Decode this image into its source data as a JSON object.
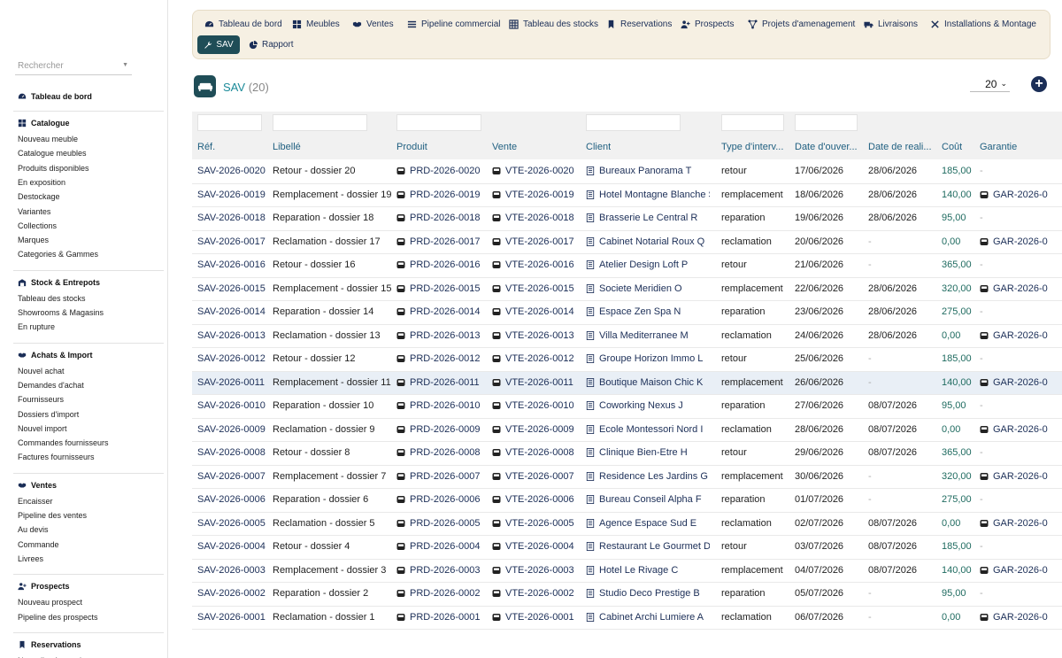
{
  "sidebar": {
    "search_placeholder": "Rechercher",
    "dashboard": "Tableau de bord",
    "sections": [
      {
        "title": "Catalogue",
        "icon": "grid-icon",
        "items": [
          "Nouveau meuble",
          "Catalogue meubles",
          "Produits disponibles",
          "En exposition",
          "Destockage",
          "Variantes",
          "Collections",
          "Marques",
          "Categories & Gammes"
        ]
      },
      {
        "title": "Stock & Entrepots",
        "icon": "warehouse-icon",
        "items": [
          "Tableau des stocks",
          "Showrooms & Magasins",
          "En rupture"
        ]
      },
      {
        "title": "Achats & Import",
        "icon": "handshake-icon",
        "items": [
          "Nouvel achat",
          "Demandes d'achat",
          "Fournisseurs",
          "Dossiers d'import",
          "Nouvel import",
          "Commandes fournisseurs",
          "Factures fournisseurs"
        ]
      },
      {
        "title": "Ventes",
        "icon": "handshake-icon",
        "items": [
          "Encaisser",
          "Pipeline des ventes",
          "Au devis",
          "Commande",
          "Livrees"
        ]
      },
      {
        "title": "Prospects",
        "icon": "user-plus-icon",
        "items": [
          "Nouveau prospect",
          "Pipeline des prospects"
        ]
      },
      {
        "title": "Reservations",
        "icon": "bookmark-icon",
        "items": [
          "Nouvelle réservation"
        ]
      }
    ]
  },
  "topnav": {
    "items": [
      {
        "label": "Tableau de bord",
        "icon": "dashboard-icon"
      },
      {
        "label": "Meubles",
        "icon": "grid-icon"
      },
      {
        "label": "Ventes",
        "icon": "handshake-icon"
      },
      {
        "label": "Pipeline commercial",
        "icon": "list-icon"
      },
      {
        "label": "Tableau des stocks",
        "icon": "table-icon"
      },
      {
        "label": "Reservations",
        "icon": "bookmark-icon"
      },
      {
        "label": "Prospects",
        "icon": "user-plus-icon"
      },
      {
        "label": "Projets d'amenagement",
        "icon": "project-icon"
      },
      {
        "label": "Livraisons",
        "icon": "truck-icon"
      },
      {
        "label": "Installations & Montage",
        "icon": "tools-icon"
      }
    ],
    "active": {
      "label": "SAV",
      "icon": "wrench-icon"
    },
    "report": {
      "label": "Rapport",
      "icon": "pie-icon"
    }
  },
  "page": {
    "title": "SAV",
    "count": "(20)",
    "per_page": "20",
    "colors": {
      "accent": "#1b8a99",
      "primary": "#1b2e57",
      "active_bg": "#1f4d57",
      "money": "#1f6b60"
    }
  },
  "table": {
    "columns": [
      "Réf.",
      "Libellé",
      "Produit",
      "Vente",
      "Client",
      "Type d'interv...",
      "Date d'ouver...",
      "Date de reali...",
      "Coût",
      "Garantie"
    ],
    "rows": [
      {
        "ref": "SAV-2026-0020",
        "libelle": "Retour - dossier 20",
        "produit": "PRD-2026-0020",
        "vente": "VTE-2026-0020",
        "client": "Bureaux Panorama T",
        "type": "retour",
        "ouverture": "17/06/2026",
        "realisation": "28/06/2026",
        "cout": "185,00",
        "garantie": "-"
      },
      {
        "ref": "SAV-2026-0019",
        "libelle": "Remplacement - dossier 19",
        "produit": "PRD-2026-0019",
        "vente": "VTE-2026-0019",
        "client": "Hotel Montagne Blanche S",
        "type": "remplacement",
        "ouverture": "18/06/2026",
        "realisation": "28/06/2026",
        "cout": "140,00",
        "garantie": "GAR-2026-0"
      },
      {
        "ref": "SAV-2026-0018",
        "libelle": "Reparation - dossier 18",
        "produit": "PRD-2026-0018",
        "vente": "VTE-2026-0018",
        "client": "Brasserie Le Central R",
        "type": "reparation",
        "ouverture": "19/06/2026",
        "realisation": "28/06/2026",
        "cout": "95,00",
        "garantie": "-"
      },
      {
        "ref": "SAV-2026-0017",
        "libelle": "Reclamation - dossier 17",
        "produit": "PRD-2026-0017",
        "vente": "VTE-2026-0017",
        "client": "Cabinet Notarial Roux Q",
        "type": "reclamation",
        "ouverture": "20/06/2026",
        "realisation": "-",
        "cout": "0,00",
        "garantie": "GAR-2026-0"
      },
      {
        "ref": "SAV-2026-0016",
        "libelle": "Retour - dossier 16",
        "produit": "PRD-2026-0016",
        "vente": "VTE-2026-0016",
        "client": "Atelier Design Loft P",
        "type": "retour",
        "ouverture": "21/06/2026",
        "realisation": "-",
        "cout": "365,00",
        "garantie": "-"
      },
      {
        "ref": "SAV-2026-0015",
        "libelle": "Remplacement - dossier 15",
        "produit": "PRD-2026-0015",
        "vente": "VTE-2026-0015",
        "client": "Societe Meridien O",
        "type": "remplacement",
        "ouverture": "22/06/2026",
        "realisation": "28/06/2026",
        "cout": "320,00",
        "garantie": "GAR-2026-0"
      },
      {
        "ref": "SAV-2026-0014",
        "libelle": "Reparation - dossier 14",
        "produit": "PRD-2026-0014",
        "vente": "VTE-2026-0014",
        "client": "Espace Zen Spa N",
        "type": "reparation",
        "ouverture": "23/06/2026",
        "realisation": "28/06/2026",
        "cout": "275,00",
        "garantie": "-"
      },
      {
        "ref": "SAV-2026-0013",
        "libelle": "Reclamation - dossier 13",
        "produit": "PRD-2026-0013",
        "vente": "VTE-2026-0013",
        "client": "Villa Mediterranee M",
        "type": "reclamation",
        "ouverture": "24/06/2026",
        "realisation": "28/06/2026",
        "cout": "0,00",
        "garantie": "GAR-2026-0"
      },
      {
        "ref": "SAV-2026-0012",
        "libelle": "Retour - dossier 12",
        "produit": "PRD-2026-0012",
        "vente": "VTE-2026-0012",
        "client": "Groupe Horizon Immo L",
        "type": "retour",
        "ouverture": "25/06/2026",
        "realisation": "-",
        "cout": "185,00",
        "garantie": "-"
      },
      {
        "ref": "SAV-2026-0011",
        "libelle": "Remplacement - dossier 11",
        "produit": "PRD-2026-0011",
        "vente": "VTE-2026-0011",
        "client": "Boutique Maison Chic K",
        "type": "remplacement",
        "ouverture": "26/06/2026",
        "realisation": "-",
        "cout": "140,00",
        "garantie": "GAR-2026-0"
      },
      {
        "ref": "SAV-2026-0010",
        "libelle": "Reparation - dossier 10",
        "produit": "PRD-2026-0010",
        "vente": "VTE-2026-0010",
        "client": "Coworking Nexus J",
        "type": "reparation",
        "ouverture": "27/06/2026",
        "realisation": "08/07/2026",
        "cout": "95,00",
        "garantie": "-"
      },
      {
        "ref": "SAV-2026-0009",
        "libelle": "Reclamation - dossier 9",
        "produit": "PRD-2026-0009",
        "vente": "VTE-2026-0009",
        "client": "Ecole Montessori Nord I",
        "type": "reclamation",
        "ouverture": "28/06/2026",
        "realisation": "08/07/2026",
        "cout": "0,00",
        "garantie": "GAR-2026-0"
      },
      {
        "ref": "SAV-2026-0008",
        "libelle": "Retour - dossier 8",
        "produit": "PRD-2026-0008",
        "vente": "VTE-2026-0008",
        "client": "Clinique Bien-Etre H",
        "type": "retour",
        "ouverture": "29/06/2026",
        "realisation": "08/07/2026",
        "cout": "365,00",
        "garantie": "-"
      },
      {
        "ref": "SAV-2026-0007",
        "libelle": "Remplacement - dossier 7",
        "produit": "PRD-2026-0007",
        "vente": "VTE-2026-0007",
        "client": "Residence Les Jardins G",
        "type": "remplacement",
        "ouverture": "30/06/2026",
        "realisation": "-",
        "cout": "320,00",
        "garantie": "GAR-2026-0"
      },
      {
        "ref": "SAV-2026-0006",
        "libelle": "Reparation - dossier 6",
        "produit": "PRD-2026-0006",
        "vente": "VTE-2026-0006",
        "client": "Bureau Conseil Alpha F",
        "type": "reparation",
        "ouverture": "01/07/2026",
        "realisation": "-",
        "cout": "275,00",
        "garantie": "-"
      },
      {
        "ref": "SAV-2026-0005",
        "libelle": "Reclamation - dossier 5",
        "produit": "PRD-2026-0005",
        "vente": "VTE-2026-0005",
        "client": "Agence Espace Sud E",
        "type": "reclamation",
        "ouverture": "02/07/2026",
        "realisation": "08/07/2026",
        "cout": "0,00",
        "garantie": "GAR-2026-0"
      },
      {
        "ref": "SAV-2026-0004",
        "libelle": "Retour - dossier 4",
        "produit": "PRD-2026-0004",
        "vente": "VTE-2026-0004",
        "client": "Restaurant Le Gourmet D",
        "type": "retour",
        "ouverture": "03/07/2026",
        "realisation": "08/07/2026",
        "cout": "185,00",
        "garantie": "-"
      },
      {
        "ref": "SAV-2026-0003",
        "libelle": "Remplacement - dossier 3",
        "produit": "PRD-2026-0003",
        "vente": "VTE-2026-0003",
        "client": "Hotel Le Rivage C",
        "type": "remplacement",
        "ouverture": "04/07/2026",
        "realisation": "08/07/2026",
        "cout": "140,00",
        "garantie": "GAR-2026-0"
      },
      {
        "ref": "SAV-2026-0002",
        "libelle": "Reparation - dossier 2",
        "produit": "PRD-2026-0002",
        "vente": "VTE-2026-0002",
        "client": "Studio Deco Prestige B",
        "type": "reparation",
        "ouverture": "05/07/2026",
        "realisation": "-",
        "cout": "95,00",
        "garantie": "-"
      },
      {
        "ref": "SAV-2026-0001",
        "libelle": "Reclamation - dossier 1",
        "produit": "PRD-2026-0001",
        "vente": "VTE-2026-0001",
        "client": "Cabinet Archi Lumiere A",
        "type": "reclamation",
        "ouverture": "06/07/2026",
        "realisation": "-",
        "cout": "0,00",
        "garantie": "GAR-2026-0"
      }
    ]
  }
}
